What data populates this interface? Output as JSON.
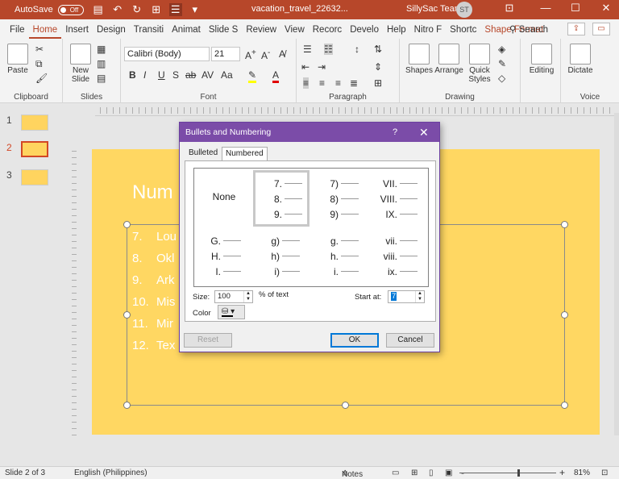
{
  "titlebar": {
    "autosave_label": "AutoSave",
    "autosave_state": "Off",
    "document_title": "vacation_travel_22632...",
    "user_name": "SillySac Team",
    "user_initials": "ST"
  },
  "ribbon_tabs": [
    "File",
    "Home",
    "Insert",
    "Design",
    "Transiti",
    "Animat",
    "Slide S",
    "Review",
    "View",
    "Recorc",
    "Develo",
    "Help",
    "Nitro F",
    "Shortc",
    "Shape Format"
  ],
  "active_tab": "Home",
  "search_label": "Search",
  "ribbon": {
    "clipboard": {
      "paste": "Paste",
      "label": "Clipboard"
    },
    "slides": {
      "new_slide": "New Slide",
      "label": "Slides"
    },
    "font": {
      "font_name": "Calibri (Body)",
      "font_size": "21",
      "label": "Font"
    },
    "paragraph": {
      "label": "Paragraph"
    },
    "drawing": {
      "shapes": "Shapes",
      "arrange": "Arrange",
      "quick_styles": "Quick Styles",
      "label": "Drawing"
    },
    "editing": {
      "label": "Editing"
    },
    "voice": {
      "dictate": "Dictate",
      "label": "Voice"
    }
  },
  "thumbnails": [
    "1",
    "2",
    "3"
  ],
  "slide": {
    "title": "Num",
    "list": [
      {
        "num": "7.",
        "text": "Lou"
      },
      {
        "num": "8.",
        "text": "Okl"
      },
      {
        "num": "9.",
        "text": "Ark"
      },
      {
        "num": "10.",
        "text": "Mis"
      },
      {
        "num": "11.",
        "text": "Mir"
      },
      {
        "num": "12.",
        "text": "Tex"
      }
    ]
  },
  "dialog": {
    "title": "Bullets and Numbering",
    "help": "?",
    "close": "✕",
    "tabs": [
      "Bulleted",
      "Numbered"
    ],
    "selected_tab": "Numbered",
    "none_label": "None",
    "styles": [
      [
        "7.",
        "8.",
        "9."
      ],
      [
        "7)",
        "8)",
        "9)"
      ],
      [
        "VII.",
        "VIII.",
        "IX."
      ],
      [
        "G.",
        "H.",
        "I."
      ],
      [
        "g)",
        "h)",
        "i)"
      ],
      [
        "g.",
        "h.",
        "i."
      ],
      [
        "vii.",
        "viii.",
        "ix."
      ]
    ],
    "size_label": "Size:",
    "size_value": "100",
    "size_unit": "% of text",
    "start_label": "Start at:",
    "start_value": "7",
    "color_label": "Color",
    "reset": "Reset",
    "ok": "OK",
    "cancel": "Cancel"
  },
  "status": {
    "slide_info": "Slide 2 of 3",
    "language": "English (Philippines)",
    "notes": "Notes",
    "zoom": "81%",
    "minus": "-",
    "plus": "+"
  },
  "colors": {
    "accent": "#b7472a",
    "dialog_title": "#7b4ca8",
    "slide_bg": "#ffd762"
  }
}
